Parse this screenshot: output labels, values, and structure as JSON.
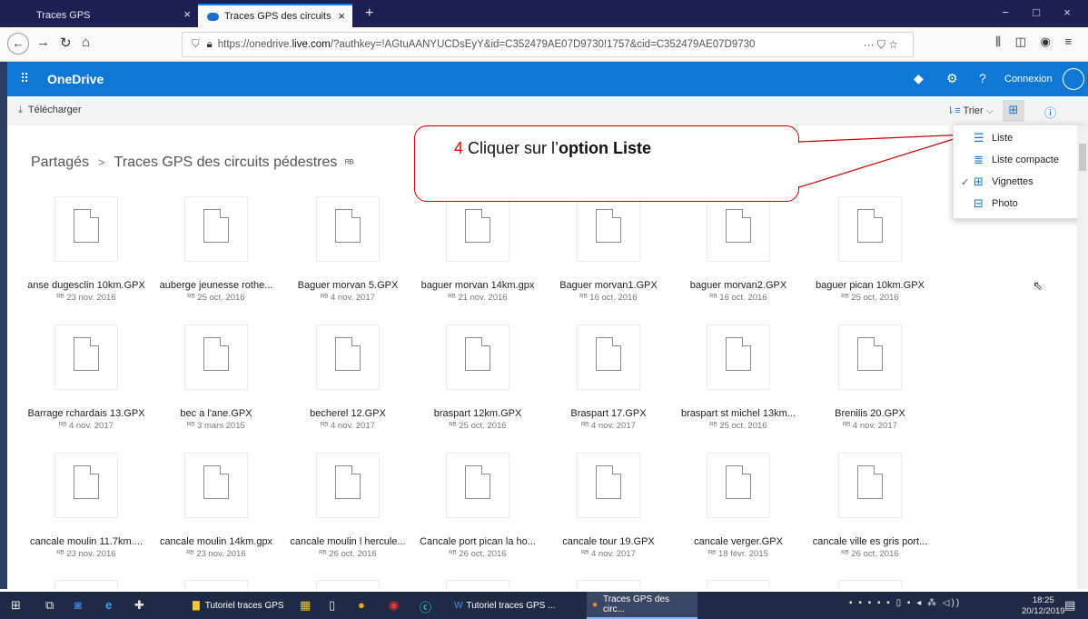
{
  "browser": {
    "tabs": [
      {
        "label": "Traces GPS",
        "close": "×"
      },
      {
        "label": "Traces GPS des circuits pédestr",
        "close": "×"
      }
    ],
    "new_tab": "+",
    "window_buttons": [
      "−",
      "□",
      "×"
    ],
    "url_prefix": "https://onedrive.",
    "url_domain": "live.com",
    "url_rest": "/?authkey=!AGtuAANYUCDsEyY&id=C352479AE07D9730!1757&cid=C352479AE07D9730",
    "url_actions": "··· ⛉ ☆",
    "toolbar_right": "⫼ ◫ ◉ ≡"
  },
  "onedrive": {
    "brand": "OneDrive",
    "connexion": "Connexion",
    "download": "Télécharger",
    "sort": "Trier",
    "breadcrumb_root": "Partagés",
    "breadcrumb_sep": ">",
    "breadcrumb_current": "Traces GPS des circuits pédestres",
    "shared_glyph": "ᴿᴮ"
  },
  "view_menu": {
    "items": [
      {
        "label": "Liste",
        "icon": "list-icon",
        "checked": false
      },
      {
        "label": "Liste compacte",
        "icon": "compact-list-icon",
        "checked": false
      },
      {
        "label": "Vignettes",
        "icon": "tiles-icon",
        "checked": true
      },
      {
        "label": "Photo",
        "icon": "photo-icon",
        "checked": false
      }
    ]
  },
  "callout": {
    "number": "4",
    "text_before": " Cliquer sur l’",
    "text_bold": "option Liste"
  },
  "files": [
    {
      "name": "anse dugesclin 10km.GPX",
      "date": "23 nov. 2016"
    },
    {
      "name": "auberge jeunesse rothe...",
      "date": "25 oct. 2016"
    },
    {
      "name": "Baguer morvan 5.GPX",
      "date": "4 nov. 2017"
    },
    {
      "name": "baguer morvan 14km.gpx",
      "date": "21 nov. 2016"
    },
    {
      "name": "Baguer morvan1.GPX",
      "date": "16 oct. 2016"
    },
    {
      "name": "baguer morvan2.GPX",
      "date": "16 oct. 2016"
    },
    {
      "name": "baguer pican 10km.GPX",
      "date": "25 oct. 2016"
    },
    {
      "name": "Barrage rchardais 13.GPX",
      "date": "4 nov. 2017"
    },
    {
      "name": "bec a l'ane.GPX",
      "date": "3 mars 2015"
    },
    {
      "name": "becherel 12.GPX",
      "date": "4 nov. 2017"
    },
    {
      "name": "braspart 12km.GPX",
      "date": "25 oct. 2016"
    },
    {
      "name": "Braspart 17.GPX",
      "date": "4 nov. 2017"
    },
    {
      "name": "braspart st michel 13km...",
      "date": "25 oct. 2016"
    },
    {
      "name": "Brenilis 20.GPX",
      "date": "4 nov. 2017"
    },
    {
      "name": "cancale moulin 11.7km....",
      "date": "23 nov. 2016"
    },
    {
      "name": "cancale moulin 14km.gpx",
      "date": "23 nov. 2016"
    },
    {
      "name": "cancale moulin l hercule...",
      "date": "26 oct. 2016"
    },
    {
      "name": "Cancale port pican la ho...",
      "date": "26 oct. 2016"
    },
    {
      "name": "cancale tour 19.GPX",
      "date": "4 nov. 2017"
    },
    {
      "name": "cancale verger.GPX",
      "date": "18 févr. 2015"
    },
    {
      "name": "cancale ville es gris port...",
      "date": "26 oct. 2016"
    }
  ],
  "taskbar": {
    "apps": [
      {
        "label": "Tutoriel traces GPS"
      },
      {
        "label": "Tutoriel traces GPS ..."
      },
      {
        "label": "Traces GPS des circ..."
      }
    ],
    "time": "18:25",
    "date": "20/12/2019",
    "tray": "▪ ▪ ▪ ▪ ▪ ▯ ▪ ◂  ⁂ ◁))"
  }
}
